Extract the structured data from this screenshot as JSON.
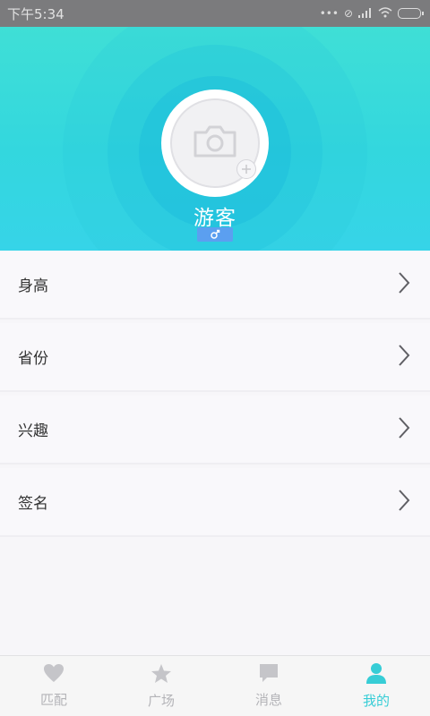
{
  "status_bar": {
    "time": "下午5:34"
  },
  "profile": {
    "nickname": "游客",
    "gender_symbol": "♂"
  },
  "rows": [
    {
      "label": "身高"
    },
    {
      "label": "省份"
    },
    {
      "label": "兴趣"
    },
    {
      "label": "签名"
    }
  ],
  "tabs": [
    {
      "label": "匹配",
      "icon": "heart-icon"
    },
    {
      "label": "广场",
      "icon": "star-icon"
    },
    {
      "label": "消息",
      "icon": "message-icon"
    },
    {
      "label": "我的",
      "icon": "person-icon",
      "active": true
    }
  ],
  "colors": {
    "accent": "#37cdd6",
    "header_gradient_start": "#3fdfd6",
    "header_gradient_end": "#36d4e8",
    "gender_badge": "#5b9ff0"
  }
}
